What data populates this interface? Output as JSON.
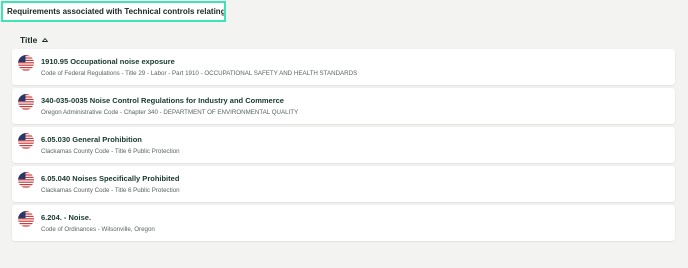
{
  "header": {
    "title": "Requirements associated with Technical controls relating to noise"
  },
  "sort": {
    "label": "Title",
    "icon": "sort-ascending-icon"
  },
  "colors": {
    "accent_border": "#3fe3b4",
    "title_text": "#17382e",
    "flag_red": "#c53b3b",
    "flag_blue": "#27366b"
  },
  "requirements": [
    {
      "title": "1910.95 Occupational noise exposure",
      "source": "Code of Federal Regulations - Title 29 - Labor - Part 1910 - OCCUPATIONAL SAFETY AND HEALTH STANDARDS",
      "icon": "us-flag-icon"
    },
    {
      "title": "340-035-0035 Noise Control Regulations for Industry and Commerce",
      "source": "Oregon Administrative Code - Chapter 340 - DEPARTMENT OF ENVIRONMENTAL QUALITY",
      "icon": "us-flag-icon"
    },
    {
      "title": "6.05.030 General Prohibition",
      "source": "Clackamas County Code - Title 6 Public Protection",
      "icon": "us-flag-icon"
    },
    {
      "title": "6.05.040 Noises Specifically Prohibited",
      "source": "Clackamas County Code - Title 6 Public Protection",
      "icon": "us-flag-icon"
    },
    {
      "title": "6.204. - Noise.",
      "source": "Code of Ordinances - Wilsonville, Oregon",
      "icon": "us-flag-icon"
    }
  ]
}
